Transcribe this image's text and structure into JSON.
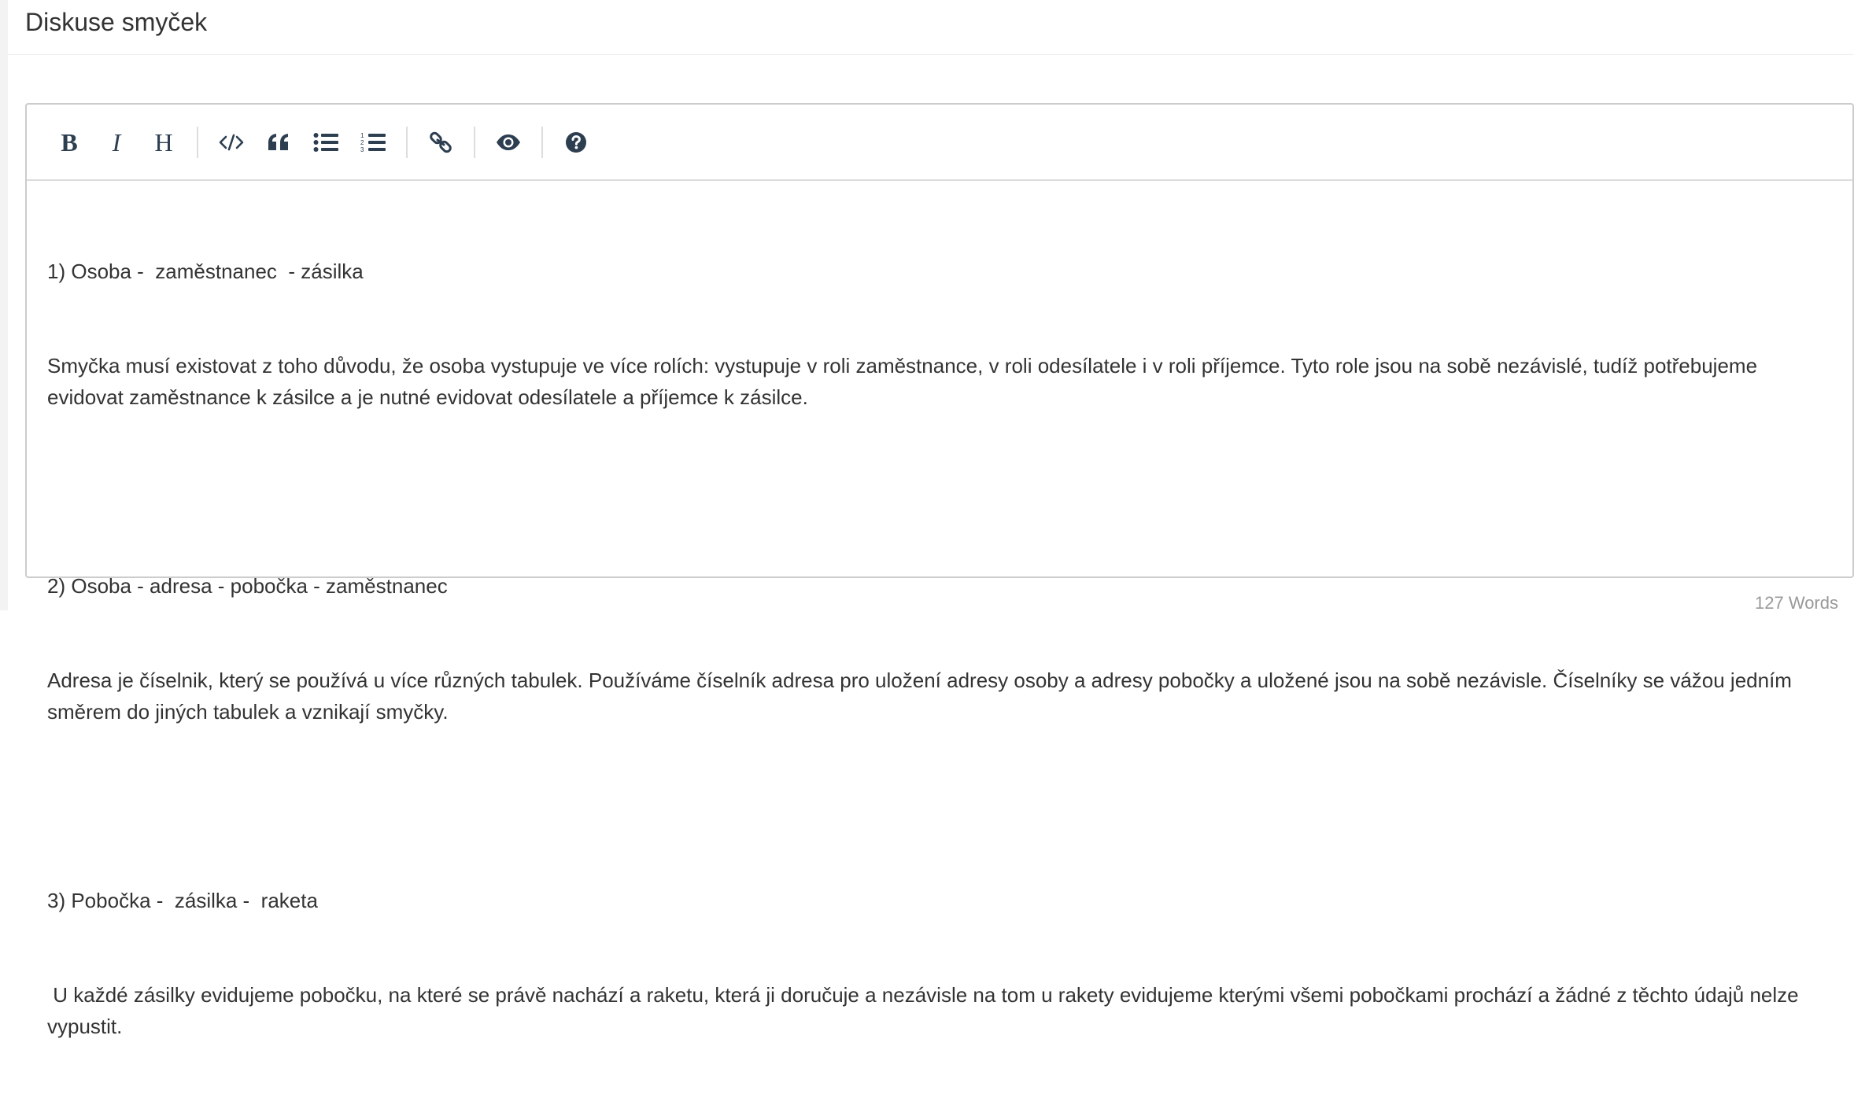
{
  "panel": {
    "title": "Diskuse smyček"
  },
  "toolbar": {
    "bold_label": "B",
    "italic_label": "I",
    "heading_label": "H"
  },
  "content": {
    "paragraphs": [
      [
        "1) Osoba -  zaměstnanec  - zásilka",
        "Smyčka musí existovat z toho důvodu, že osoba vystupuje ve více rolích: vystupuje v roli zaměstnance, v roli odesílatele i v roli příjemce. Tyto role jsou na sobě nezávislé, tudíž potřebujeme evidovat zaměstnance k zásilce a je nutné evidovat odesílatele a příjemce k zásilce."
      ],
      [
        "2) Osoba - adresa - pobočka - zaměstnanec",
        "Adresa je číselnik, který se používá u více různých tabulek. Používáme číselník adresa pro uložení adresy osoby a adresy pobočky a uložené jsou na sobě nezávisle. Číselníky se vážou jedním směrem do jiných tabulek a vznikají smyčky."
      ],
      [
        "3) Pobočka -  zásilka -  raketa",
        " U každé zásilky evidujeme pobočku, na které se právě nachází a raketu, která ji doručuje a nezávisle na tom u rakety evidujeme kterými všemi pobočkami prochází a žádné z těchto údajů nelze vypustit."
      ]
    ]
  },
  "status": {
    "word_count": "127 Words"
  },
  "colors": {
    "toolbar_icon": "#2c3e50",
    "text": "#333333",
    "border": "#cccccc",
    "muted": "#999999"
  }
}
